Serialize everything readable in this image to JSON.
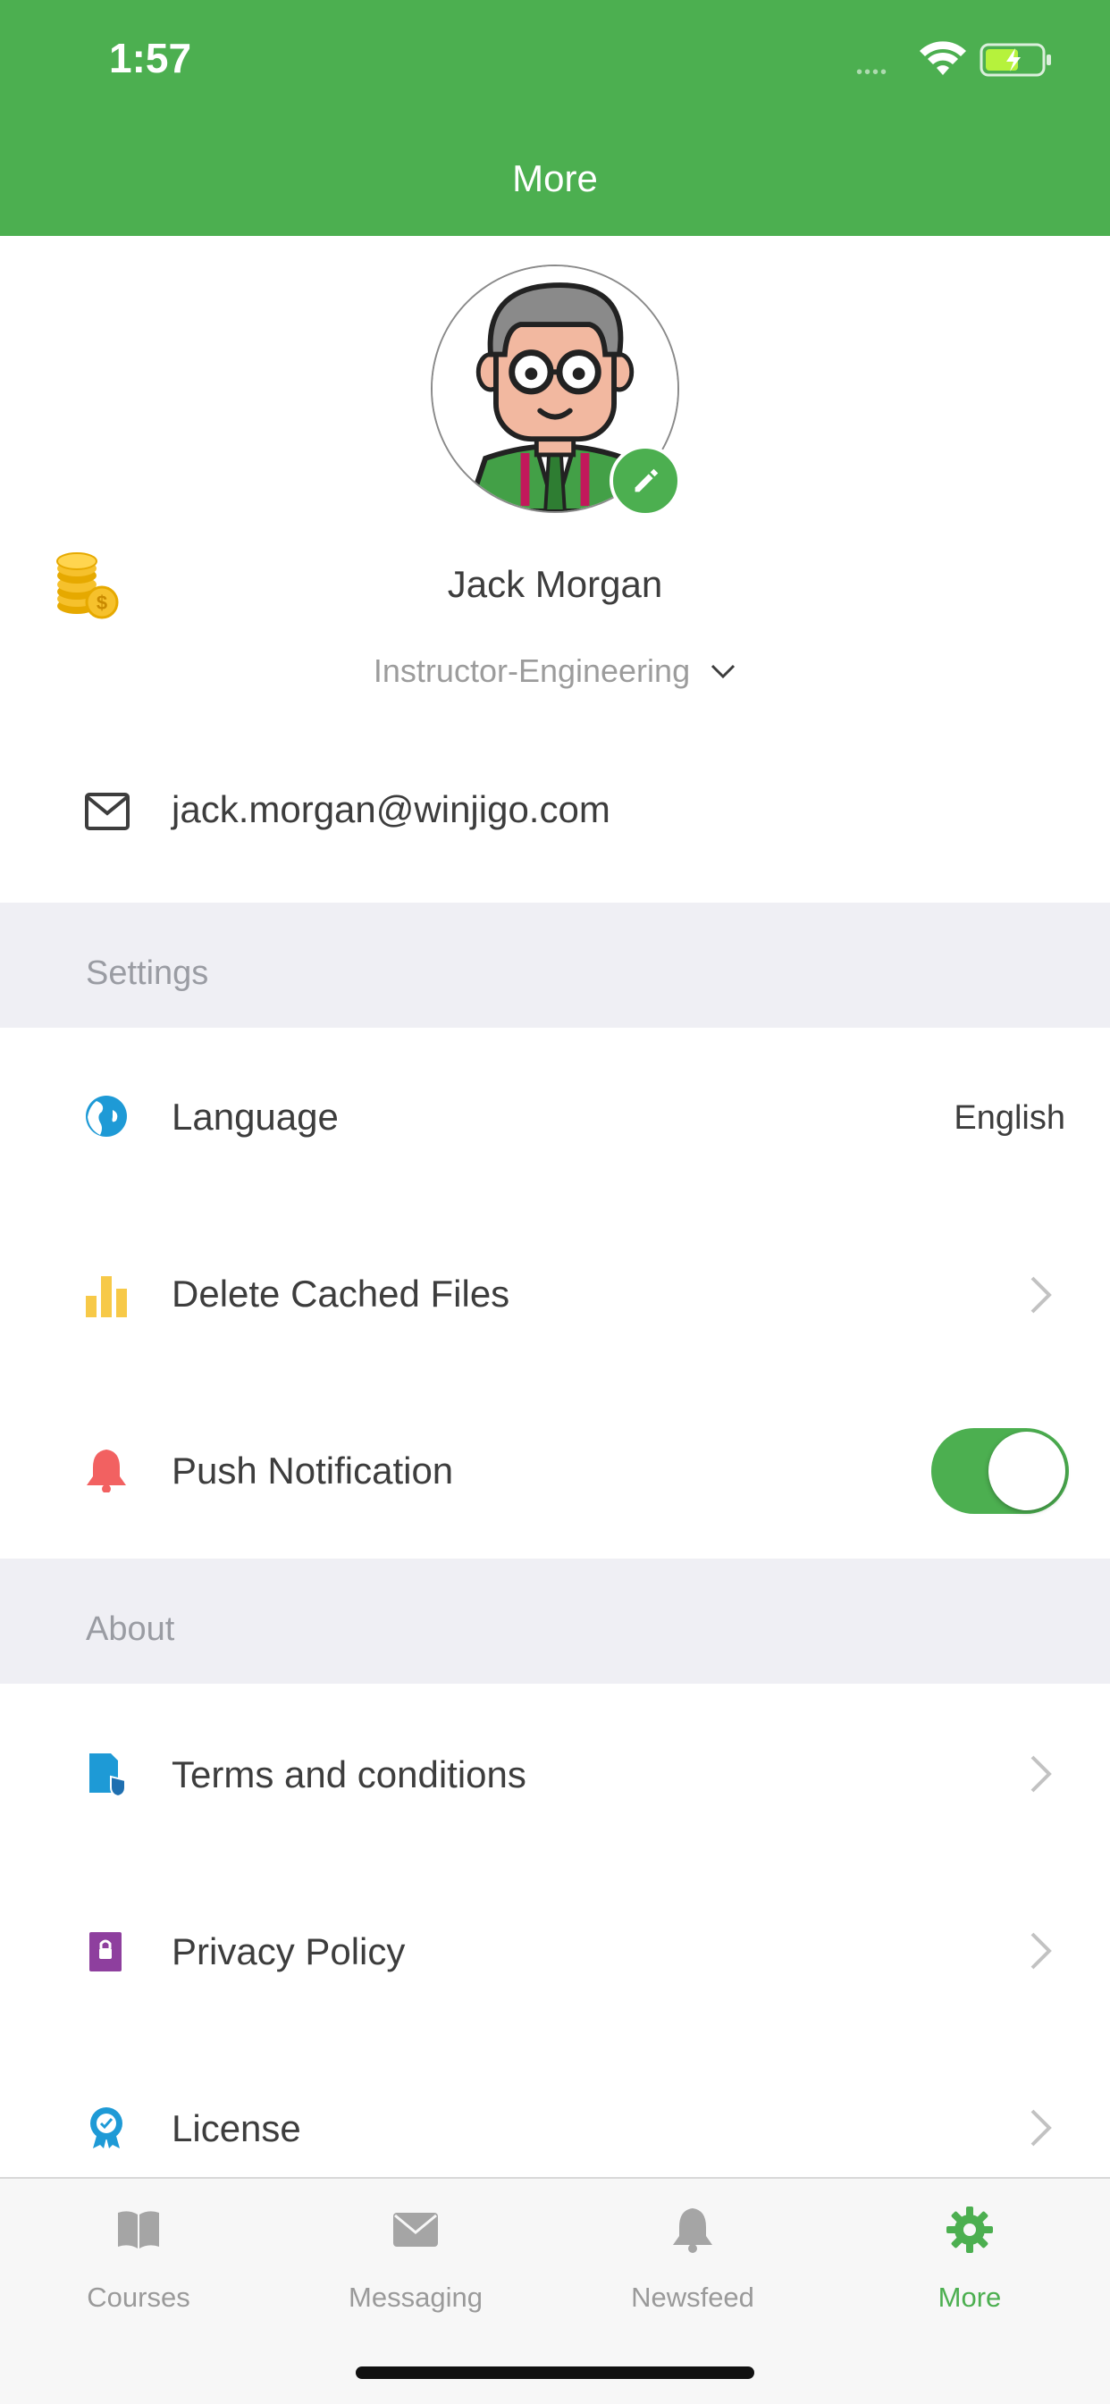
{
  "status_bar": {
    "time": "1:57",
    "signal": "••••"
  },
  "header": {
    "title": "More"
  },
  "profile": {
    "name": "Jack Morgan",
    "role": "Instructor-Engineering",
    "email": "jack.morgan@winjigo.com"
  },
  "sections": {
    "settings_label": "Settings",
    "about_label": "About"
  },
  "settings": {
    "language_label": "Language",
    "language_value": "English",
    "cache_label": "Delete Cached Files",
    "push_label": "Push Notification",
    "push_enabled": true
  },
  "about": {
    "terms_label": "Terms and conditions",
    "privacy_label": "Privacy Policy",
    "license_label": "License"
  },
  "tabs": [
    {
      "label": "Courses",
      "icon": "book-icon"
    },
    {
      "label": "Messaging",
      "icon": "envelope-icon"
    },
    {
      "label": "Newsfeed",
      "icon": "bell-icon"
    },
    {
      "label": "More",
      "icon": "gear-icon",
      "active": true
    }
  ],
  "colors": {
    "accent": "#4caf50",
    "section_bg": "#efeff4"
  }
}
